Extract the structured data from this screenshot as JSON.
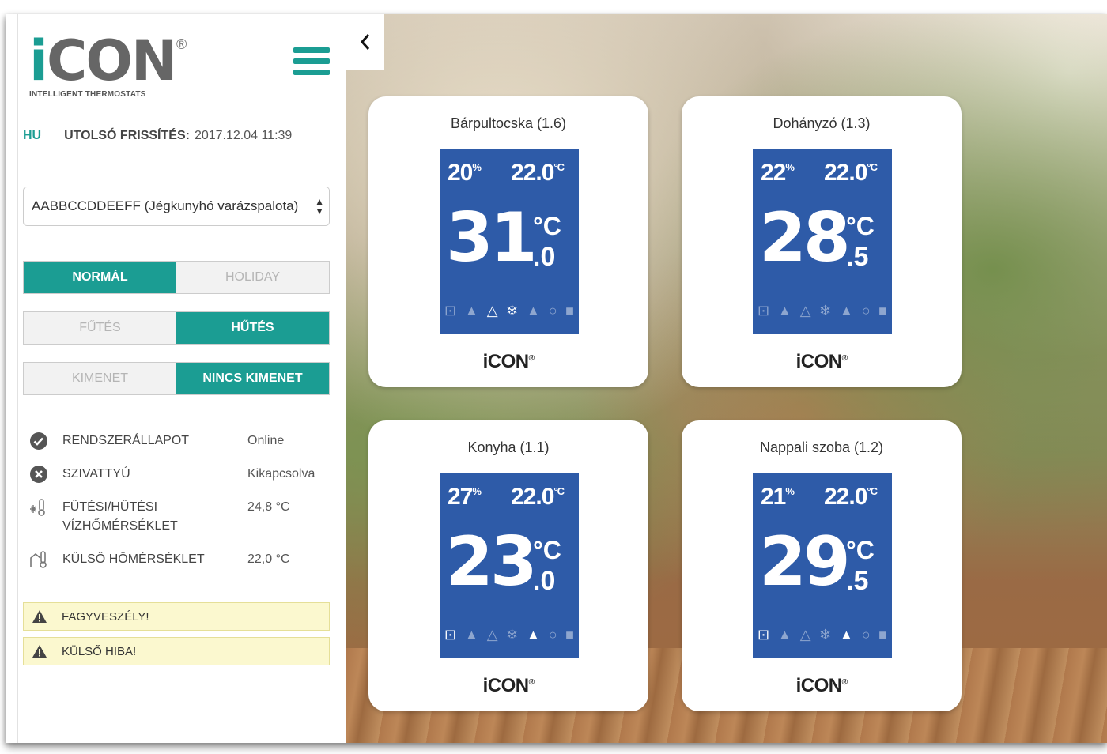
{
  "brand": {
    "logo_text": "iCON",
    "registered": "®",
    "tagline": "INTELLIGENT THERMOSTATS"
  },
  "header": {
    "language": "HU",
    "last_refresh_label": "UTOLSÓ FRISSÍTÉS:",
    "last_refresh_value": "2017.12.04 11:39"
  },
  "device_select": {
    "selected": "AABBCCDDEEFF (Jégkunyhó varázspalota)"
  },
  "modes": {
    "normal": "NORMÁL",
    "holiday": "HOLIDAY",
    "heating": "FŰTÉS",
    "cooling": "HŰTÉS",
    "output": "KIMENET",
    "no_output": "NINCS KIMENET"
  },
  "status": [
    {
      "label": "RENDSZERÁLLAPOT",
      "value": "Online"
    },
    {
      "label": "SZIVATTYÚ",
      "value": "Kikapcsolva"
    },
    {
      "label": "FŰTÉSI/HŰTÉSI VÍZHŐMÉRSÉKLET",
      "value": "24,8 °C"
    },
    {
      "label": "KÜLSŐ HŐMÉRSÉKLET",
      "value": "22,0 °C"
    }
  ],
  "alerts": [
    {
      "text": "FAGYVESZÉLY!"
    },
    {
      "text": "KÜLSŐ HIBA!"
    }
  ],
  "thermostats": [
    {
      "name": "Bárpultocska (1.6)",
      "humidity": "20",
      "humidity_unit": "%",
      "setpoint": "22.0",
      "setpoint_unit": "°C",
      "temp_int": "31",
      "temp_dec": ".0",
      "temp_unit": "°C",
      "brand": "iCON"
    },
    {
      "name": "Dohányzó (1.3)",
      "humidity": "22",
      "humidity_unit": "%",
      "setpoint": "22.0",
      "setpoint_unit": "°C",
      "temp_int": "28",
      "temp_dec": ".5",
      "temp_unit": "°C",
      "brand": "iCON"
    },
    {
      "name": "Konyha (1.1)",
      "humidity": "27",
      "humidity_unit": "%",
      "setpoint": "22.0",
      "setpoint_unit": "°C",
      "temp_int": "23",
      "temp_dec": ".0",
      "temp_unit": "°C",
      "brand": "iCON"
    },
    {
      "name": "Nappali szoba (1.2)",
      "humidity": "21",
      "humidity_unit": "%",
      "setpoint": "22.0",
      "setpoint_unit": "°C",
      "temp_int": "29",
      "temp_dec": ".5",
      "temp_unit": "°C",
      "brand": "iCON"
    }
  ],
  "colors": {
    "accent": "#1b9d93",
    "screen": "#2e5ba8",
    "alert_bg": "#fbf8cf"
  }
}
